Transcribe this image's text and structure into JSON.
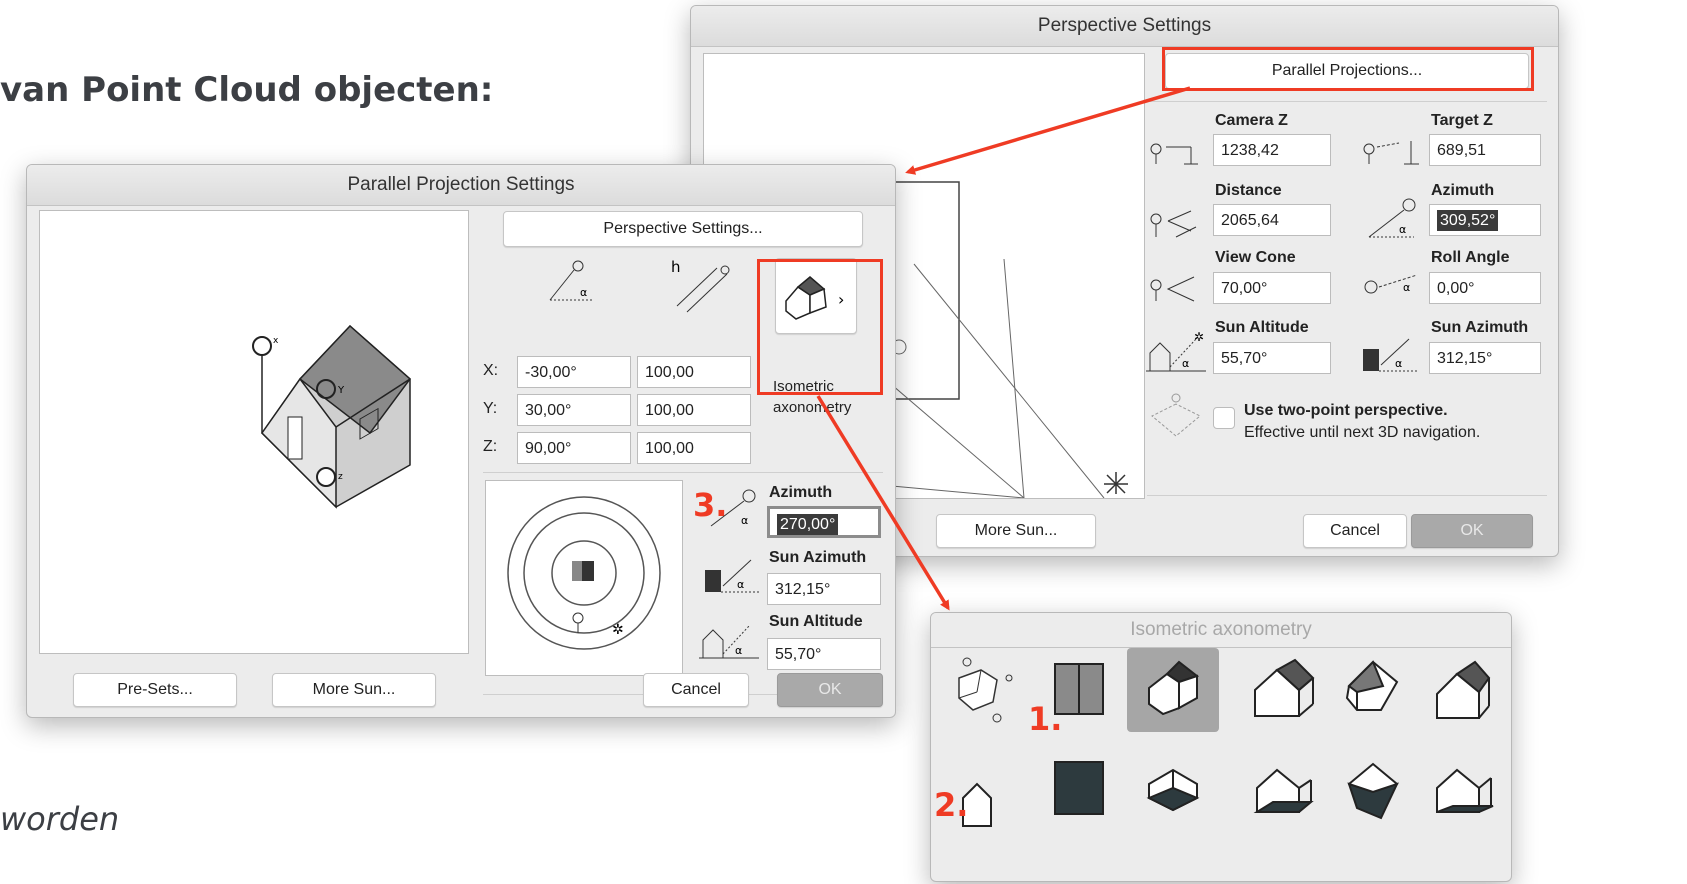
{
  "doc": {
    "heading": "van Point Cloud objecten:",
    "footer": "worden"
  },
  "perspective_dialog": {
    "title": "Perspective Settings",
    "parallel_button": "Parallel Projections...",
    "fields": {
      "camera_z": {
        "label": "Camera Z",
        "value": "1238,42"
      },
      "target_z": {
        "label": "Target Z",
        "value": "689,51"
      },
      "distance": {
        "label": "Distance",
        "value": "2065,64"
      },
      "azimuth": {
        "label": "Azimuth",
        "value": "309,52°"
      },
      "view_cone": {
        "label": "View Cone",
        "value": "70,00°"
      },
      "roll_angle": {
        "label": "Roll Angle",
        "value": "0,00°"
      },
      "sun_altitude": {
        "label": "Sun Altitude",
        "value": "55,70°"
      },
      "sun_azimuth": {
        "label": "Sun Azimuth",
        "value": "312,15°"
      }
    },
    "two_point": {
      "line1": "Use two-point perspective.",
      "line2": "Effective until next 3D navigation."
    },
    "more_sun": "More Sun...",
    "cancel": "Cancel",
    "ok": "OK"
  },
  "parallel_dialog": {
    "title": "Parallel Projection Settings",
    "perspective_button": "Perspective Settings...",
    "axes": [
      {
        "label": "X:",
        "angle": "-30,00°",
        "scale": "100,00"
      },
      {
        "label": "Y:",
        "angle": "30,00°",
        "scale": "100,00"
      },
      {
        "label": "Z:",
        "angle": "90,00°",
        "scale": "100,00"
      }
    ],
    "preset": {
      "line1": "Isometric",
      "line2": "axonometry"
    },
    "azimuth": {
      "label": "Azimuth",
      "value": "270,00°"
    },
    "sun_azimuth": {
      "label": "Sun Azimuth",
      "value": "312,15°"
    },
    "sun_altitude": {
      "label": "Sun Altitude",
      "value": "55,70°"
    },
    "axis_letters": {
      "x": "x",
      "y": "Y",
      "z": "z"
    },
    "presets_button": "Pre-Sets...",
    "more_sun": "More Sun...",
    "cancel": "Cancel",
    "ok": "OK"
  },
  "popup": {
    "title": "Isometric axonometry"
  },
  "annotations": {
    "n1": "1.",
    "n2": "2.",
    "n3": "3."
  },
  "colors": {
    "accent_red": "#ef3b24",
    "ok_button": "#a9a9a9",
    "dialog_bg": "#ececec"
  }
}
